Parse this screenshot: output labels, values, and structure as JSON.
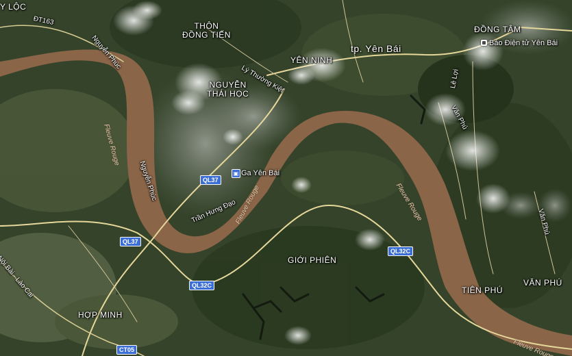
{
  "places": {
    "y_loc": "Y LỘC",
    "thon_dong_tien_1": "THÔN",
    "thon_dong_tien_2": "ĐỒNG TIẾN",
    "dong_tam": "ĐỒNG TÂM",
    "yen_ninh": "YÊN NINH",
    "nguyen_thai_hoc_1": "NGUYỄN",
    "nguyen_thai_hoc_2": "THÁI HỌC",
    "gioi_phien": "GIỚI PHIÊN",
    "hop_minh": "HỢP MINH",
    "tien_phu": "TIÊN PHÚ",
    "van_phu": "VĂN PHÚ"
  },
  "city": {
    "yen_bai": "tp. Yên Bái"
  },
  "pois": {
    "bao_dien_tu": "Báo Điện tử Yên Bái",
    "ga_yen_bai": "Ga Yên Bái"
  },
  "roads": {
    "nguyen_phuc_1": "Nguyễn Phúc",
    "nguyen_phuc_2": "Nguyễn Phúc",
    "ly_thuong_kiet": "Lý Thường Kiệt",
    "tran_hung_dao": "Trần Hưng Đạo",
    "le_loi": "Lê Lợi",
    "van_phu_road_1": "Văn Phú",
    "van_phu_road_2": "Văn Phú",
    "noi_bai_lao_cai": "Nội Bài - Lào Cai",
    "dt163": "ĐT163"
  },
  "shields": {
    "ql37_a": "QL37",
    "ql37_b": "QL37",
    "ql32c_a": "QL32C",
    "ql32c_b": "QL32C",
    "ct05": "CT05"
  },
  "river": {
    "fleuve_1": "Fleuve Rouge",
    "fleuve_2": "Fleuve Rouge",
    "fleuve_3": "Fleuve Rouge",
    "fleuve_4": "Fleuve Rouge"
  },
  "colors": {
    "river": "#8a6548",
    "forest_dark": "#25331c",
    "forest": "#3c4d2c",
    "urban": "#8e938a",
    "road_major": "#e6d79a",
    "shield_blue": "#3b6fd6"
  }
}
